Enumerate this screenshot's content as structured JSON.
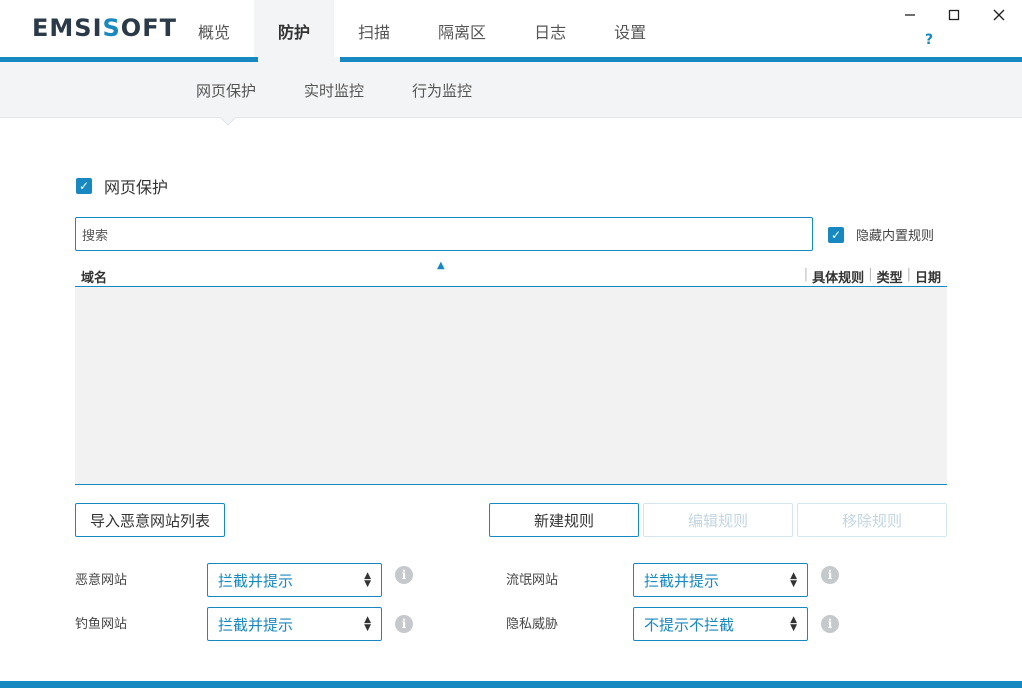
{
  "app": {
    "logo_main": "EMSI",
    "logo_accent": "S",
    "logo_tail": "OFT"
  },
  "main_tabs": [
    "概览",
    "防护",
    "扫描",
    "隔离区",
    "日志",
    "设置"
  ],
  "window": {
    "minimize": "—",
    "maximize": "☐",
    "close": "✕",
    "help": "?"
  },
  "sub_tabs": [
    "网页保护",
    "实时监控",
    "行为监控"
  ],
  "web_protection": {
    "label": "网页保护"
  },
  "search": {
    "placeholder": "搜索"
  },
  "hide_builtin": {
    "label": "隐藏内置规则"
  },
  "table": {
    "col_domain": "域名",
    "col_rule": "具体规则",
    "col_type": "类型",
    "col_date": "日期"
  },
  "buttons": {
    "import": "导入恶意网站列表",
    "new_rule": "新建规则",
    "edit_rule": "编辑规则",
    "remove_rule": "移除规则"
  },
  "options": {
    "malicious": {
      "label": "恶意网站",
      "value": "拦截并提示"
    },
    "phishing": {
      "label": "钓鱼网站",
      "value": "拦截并提示"
    },
    "pup": {
      "label": "流氓网站",
      "value": "拦截并提示"
    },
    "privacy": {
      "label": "隐私威胁",
      "value": "不提示不拦截"
    }
  },
  "colors": {
    "accent": "#1888c0",
    "panel": "#f2f4f5"
  }
}
